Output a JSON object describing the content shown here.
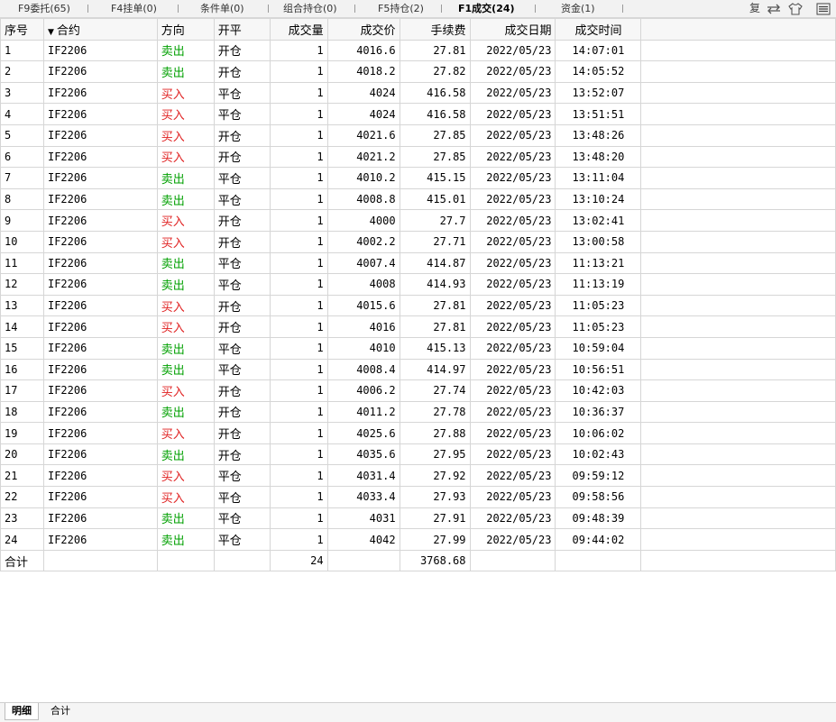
{
  "tabs": [
    {
      "label": "F9委托(65)"
    },
    {
      "label": "F4挂单(0)"
    },
    {
      "label": "条件单(0)"
    },
    {
      "label": "组合持仓(0)"
    },
    {
      "label": "F5持仓(2)"
    },
    {
      "label": "F1成交(24)",
      "active": true
    },
    {
      "label": "资金(1)"
    }
  ],
  "toolbar": {
    "fu_label": "复",
    "swap_icon": "swap-arrows-icon",
    "shirt_icon": "shirt-icon",
    "menu_icon": "hamburger-menu-icon"
  },
  "table": {
    "headers": [
      "序号",
      "合约",
      "方向",
      "开平",
      "成交量",
      "成交价",
      "手续费",
      "成交日期",
      "成交时间"
    ],
    "rows": [
      [
        "1",
        "IF2206",
        "卖出",
        "开仓",
        "1",
        "4016.6",
        "27.81",
        "2022/05/23",
        "14:07:01"
      ],
      [
        "2",
        "IF2206",
        "卖出",
        "开仓",
        "1",
        "4018.2",
        "27.82",
        "2022/05/23",
        "14:05:52"
      ],
      [
        "3",
        "IF2206",
        "买入",
        "平仓",
        "1",
        "4024",
        "416.58",
        "2022/05/23",
        "13:52:07"
      ],
      [
        "4",
        "IF2206",
        "买入",
        "平仓",
        "1",
        "4024",
        "416.58",
        "2022/05/23",
        "13:51:51"
      ],
      [
        "5",
        "IF2206",
        "买入",
        "开仓",
        "1",
        "4021.6",
        "27.85",
        "2022/05/23",
        "13:48:26"
      ],
      [
        "6",
        "IF2206",
        "买入",
        "开仓",
        "1",
        "4021.2",
        "27.85",
        "2022/05/23",
        "13:48:20"
      ],
      [
        "7",
        "IF2206",
        "卖出",
        "平仓",
        "1",
        "4010.2",
        "415.15",
        "2022/05/23",
        "13:11:04"
      ],
      [
        "8",
        "IF2206",
        "卖出",
        "平仓",
        "1",
        "4008.8",
        "415.01",
        "2022/05/23",
        "13:10:24"
      ],
      [
        "9",
        "IF2206",
        "买入",
        "开仓",
        "1",
        "4000",
        "27.7",
        "2022/05/23",
        "13:02:41"
      ],
      [
        "10",
        "IF2206",
        "买入",
        "开仓",
        "1",
        "4002.2",
        "27.71",
        "2022/05/23",
        "13:00:58"
      ],
      [
        "11",
        "IF2206",
        "卖出",
        "平仓",
        "1",
        "4007.4",
        "414.87",
        "2022/05/23",
        "11:13:21"
      ],
      [
        "12",
        "IF2206",
        "卖出",
        "平仓",
        "1",
        "4008",
        "414.93",
        "2022/05/23",
        "11:13:19"
      ],
      [
        "13",
        "IF2206",
        "买入",
        "开仓",
        "1",
        "4015.6",
        "27.81",
        "2022/05/23",
        "11:05:23"
      ],
      [
        "14",
        "IF2206",
        "买入",
        "开仓",
        "1",
        "4016",
        "27.81",
        "2022/05/23",
        "11:05:23"
      ],
      [
        "15",
        "IF2206",
        "卖出",
        "平仓",
        "1",
        "4010",
        "415.13",
        "2022/05/23",
        "10:59:04"
      ],
      [
        "16",
        "IF2206",
        "卖出",
        "平仓",
        "1",
        "4008.4",
        "414.97",
        "2022/05/23",
        "10:56:51"
      ],
      [
        "17",
        "IF2206",
        "买入",
        "开仓",
        "1",
        "4006.2",
        "27.74",
        "2022/05/23",
        "10:42:03"
      ],
      [
        "18",
        "IF2206",
        "卖出",
        "开仓",
        "1",
        "4011.2",
        "27.78",
        "2022/05/23",
        "10:36:37"
      ],
      [
        "19",
        "IF2206",
        "买入",
        "开仓",
        "1",
        "4025.6",
        "27.88",
        "2022/05/23",
        "10:06:02"
      ],
      [
        "20",
        "IF2206",
        "卖出",
        "开仓",
        "1",
        "4035.6",
        "27.95",
        "2022/05/23",
        "10:02:43"
      ],
      [
        "21",
        "IF2206",
        "买入",
        "平仓",
        "1",
        "4031.4",
        "27.92",
        "2022/05/23",
        "09:59:12"
      ],
      [
        "22",
        "IF2206",
        "买入",
        "平仓",
        "1",
        "4033.4",
        "27.93",
        "2022/05/23",
        "09:58:56"
      ],
      [
        "23",
        "IF2206",
        "卖出",
        "平仓",
        "1",
        "4031",
        "27.91",
        "2022/05/23",
        "09:48:39"
      ],
      [
        "24",
        "IF2206",
        "卖出",
        "平仓",
        "1",
        "4042",
        "27.99",
        "2022/05/23",
        "09:44:02"
      ]
    ],
    "total": {
      "label": "合计",
      "volume": "24",
      "fee": "3768.68"
    },
    "buy_label": "买入",
    "buy_color": "#e02020",
    "sell_color": "#00a000"
  },
  "bottom_tabs": [
    {
      "label": "明细",
      "active": true
    },
    {
      "label": "合计"
    }
  ]
}
